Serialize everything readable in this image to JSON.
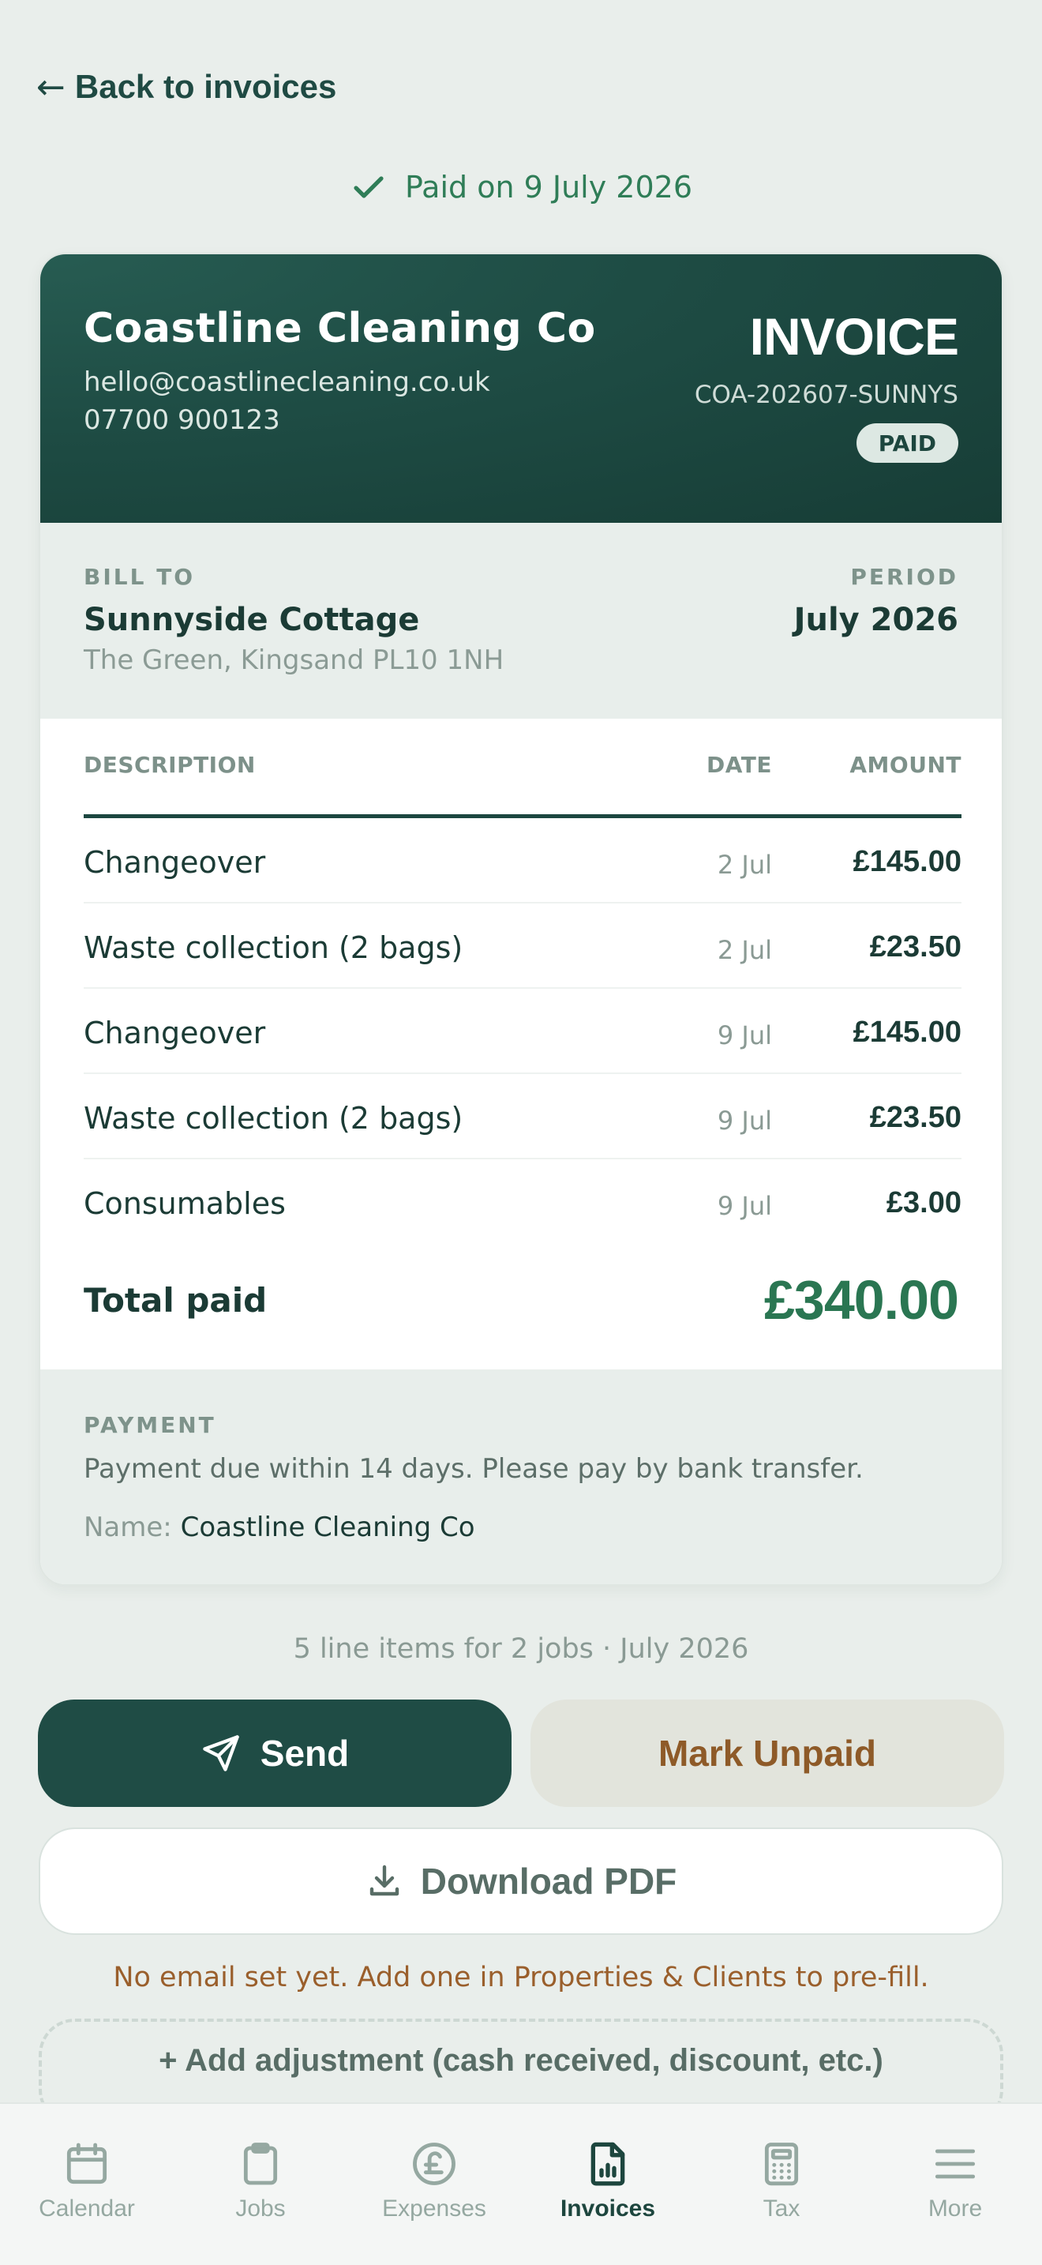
{
  "nav": {
    "back_arrow": "←",
    "back_label": "Back to invoices"
  },
  "status_banner": {
    "text": "Paid on 9 July 2026"
  },
  "invoice": {
    "business_name": "Coastline Cleaning Co",
    "business_email": "hello@coastlinecleaning.co.uk",
    "business_phone": "07700 900123",
    "title": "INVOICE",
    "number": "COA-202607-SUNNYS",
    "badge": "PAID",
    "bill_to_label": "BILL TO",
    "client_name": "Sunnyside Cottage",
    "client_address": "The Green, Kingsand PL10 1NH",
    "period_label": "PERIOD",
    "period": "July 2026",
    "columns": {
      "description": "DESCRIPTION",
      "date": "DATE",
      "amount": "AMOUNT"
    },
    "lines": [
      {
        "description": "Changeover",
        "date": "2 Jul",
        "amount": "£145.00"
      },
      {
        "description": "Waste collection (2 bags)",
        "date": "2 Jul",
        "amount": "£23.50"
      },
      {
        "description": "Changeover",
        "date": "9 Jul",
        "amount": "£145.00"
      },
      {
        "description": "Waste collection (2 bags)",
        "date": "9 Jul",
        "amount": "£23.50"
      },
      {
        "description": "Consumables",
        "date": "9 Jul",
        "amount": "£3.00"
      }
    ],
    "total_label": "Total paid",
    "total_amount": "£340.00",
    "payment_label": "PAYMENT",
    "payment_note": "Payment due within 14 days. Please pay by bank transfer.",
    "payment_name_label": "Name:",
    "payment_name": "Coastline Cleaning Co"
  },
  "summary": "5 line items for 2 jobs · July 2026",
  "actions": {
    "send": "Send",
    "mark_unpaid": "Mark Unpaid",
    "download_pdf": "Download PDF",
    "email_note": "No email set yet. Add one in Properties & Clients to pre-fill.",
    "add_adjustment": "+ Add adjustment (cash received, discount, etc.)"
  },
  "tabs": [
    {
      "label": "Calendar",
      "icon": "calendar-icon",
      "active": false
    },
    {
      "label": "Jobs",
      "icon": "clipboard-icon",
      "active": false
    },
    {
      "label": "Expenses",
      "icon": "pound-icon",
      "active": false
    },
    {
      "label": "Invoices",
      "icon": "invoice-icon",
      "active": true
    },
    {
      "label": "Tax",
      "icon": "calculator-icon",
      "active": false
    },
    {
      "label": "More",
      "icon": "menu-icon",
      "active": false
    }
  ],
  "colors": {
    "primary": "#1f4c45",
    "paid_green": "#2a7652",
    "warning_brown": "#9a5f2c",
    "background": "#e9eeeb"
  }
}
